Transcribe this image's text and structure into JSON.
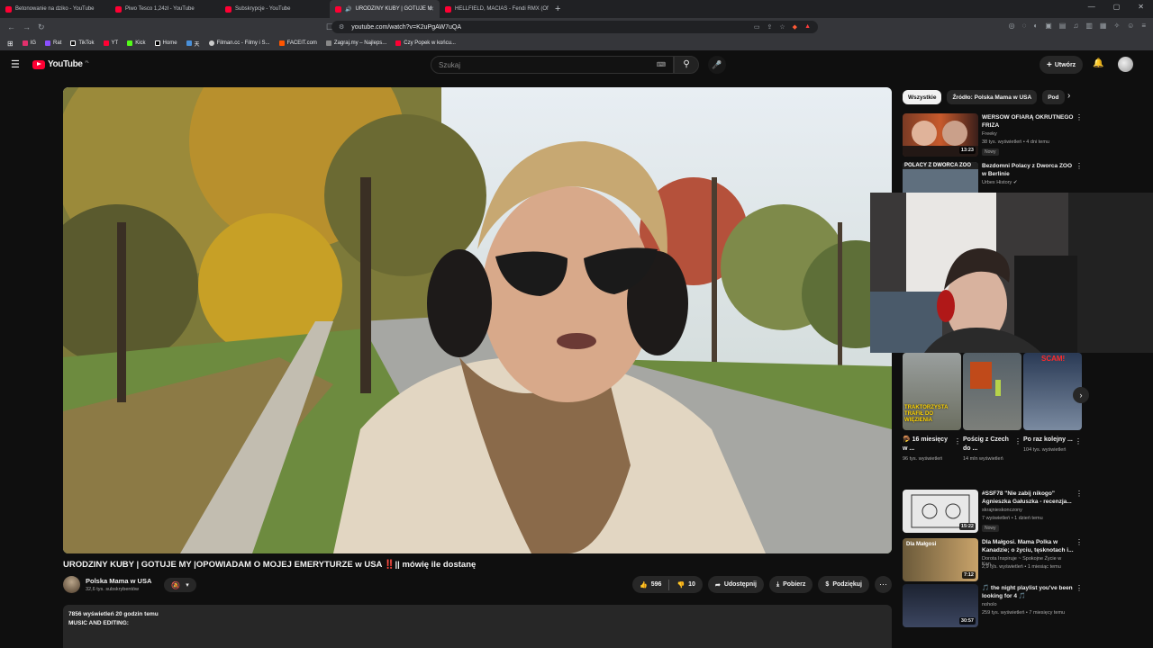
{
  "browser": {
    "tabs": [
      {
        "label": "Betonowanie na dziko - YouTube",
        "active": false
      },
      {
        "label": "Piwo Tesco 1,24zł - YouTube",
        "active": false
      },
      {
        "label": "Subskrypcje - YouTube",
        "active": false
      },
      {
        "label": "URODZINY KUBY | GOTUJE M",
        "active": true
      },
      {
        "label": "HELLFIELD, MACIAS - Fendi RMX (Of",
        "active": false
      }
    ],
    "url": "youtube.com/watch?v=K2uPgAW7uQA",
    "bookmarks": [
      "IG",
      "Rat",
      "TikTok",
      "YT",
      "Kick",
      "Home",
      "天",
      "Filman.cc - Filmy i S...",
      "FACEIT.com",
      "Zagraj.my – Najleps...",
      "Czy Popek w końcu..."
    ]
  },
  "yt": {
    "logo": "YouTube",
    "region": "PL",
    "search_placeholder": "Szukaj",
    "create_label": "Utwórz"
  },
  "video": {
    "title": "URODZINY KUBY | GOTUJE MY |OPOWIADAM O MOJEJ EMERYTURZE w USA ‼️|| mówię ile dostanę",
    "channel": "Polska Mama w USA",
    "subscribers": "32,6 tys. subskrybentów",
    "likes": "596",
    "dislikes": "10",
    "share": "Udostępnij",
    "download": "Pobierz",
    "thanks": "Podziękuj",
    "desc_line1": "7856 wyświetleń  20 godzin temu",
    "desc_line2": "MUSIC AND EDITING:"
  },
  "sidebar": {
    "chips": [
      "Wszystkie",
      "Źródło: Polska Mama w USA",
      "Pod"
    ],
    "recs_top": [
      {
        "title": "WERSOW OFIARĄ OKRUTNEGO FRIZA",
        "channel": "Freeky",
        "meta": "38 tys. wyświetleń • 4 dni temu",
        "badge": "Nowy",
        "duration": "13:23"
      },
      {
        "title": "Bezdomni Polacy z Dworca ZOO w Berlinie",
        "channel": "Urbex History ✔",
        "meta": "",
        "badge": "",
        "duration": ""
      }
    ],
    "shorts": [
      {
        "title": "🪤 16 miesięcy w ...",
        "views": "96 tys. wyświetleń"
      },
      {
        "title": "Pościg z Czech do ...",
        "views": "14 mln wyświetleń"
      },
      {
        "title": "Po raz kolejny ...",
        "views": "104 tys. wyświetleń"
      }
    ],
    "recs_bottom": [
      {
        "title": "#SSF78 \"Nie zabij nikogo\" Agnieszka Gałuszka - recenzja...",
        "channel": "skrajnieskonczony",
        "meta": "7 wyświetleń • 1 dzień temu",
        "badge": "Nowy",
        "duration": "15:22"
      },
      {
        "title": "Dla Małgosi. Mama Polka w Kanadzie; o życiu, tęsknotach i...",
        "channel": "Dorota Inspiruje ~ Spokojne Życie w Kan...",
        "meta": "2,9 tys. wyświetleń • 1 miesiąc temu",
        "badge": "",
        "duration": "7:12"
      },
      {
        "title": "🎵 the night playlist you've been looking for 4 🎵",
        "channel": "noholo",
        "meta": "259 tys. wyświetleń • 7 miesięcy temu",
        "badge": "",
        "duration": "30:57"
      }
    ],
    "thumb_texts": {
      "short1": "TRAKTORZYSTA TRAFIŁ DO WIĘZIENIA",
      "short3": "SCAM!",
      "rec2": "POLACY Z DWORCA ZOO",
      "rec4": "Dla Małgosi"
    }
  }
}
